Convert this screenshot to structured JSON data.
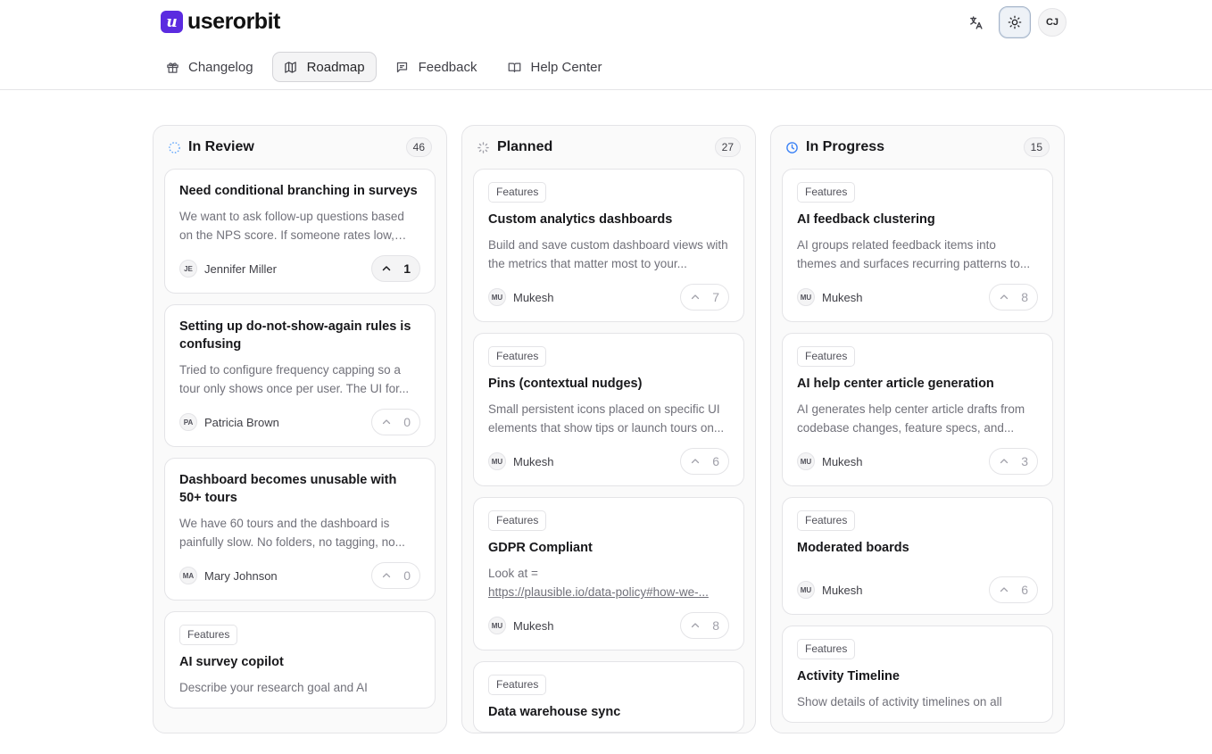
{
  "app": {
    "brand_mark": "u",
    "brand_name": "userorbit"
  },
  "topbar": {
    "translate_icon": "translate-icon",
    "theme_icon": "sun-icon",
    "avatar_initials": "CJ"
  },
  "nav": [
    {
      "label": "Changelog",
      "icon": "gift-icon",
      "active": false
    },
    {
      "label": "Roadmap",
      "icon": "map-icon",
      "active": true
    },
    {
      "label": "Feedback",
      "icon": "message-icon",
      "active": false
    },
    {
      "label": "Help Center",
      "icon": "book-icon",
      "active": false
    }
  ],
  "columns": [
    {
      "title": "In Review",
      "count": "46",
      "status_color": "#60a5fa",
      "cards": [
        {
          "tag": "",
          "title": "Need conditional branching in surveys",
          "desc": "We want to ask follow-up questions based on the NPS score. If someone rates low, as...",
          "initials": "JE",
          "author": "Jennifer Miller",
          "votes": "1",
          "voted": true
        },
        {
          "tag": "",
          "title": "Setting up do-not-show-again rules is confusing",
          "desc": "Tried to configure frequency capping so a tour only shows once per user. The UI for...",
          "initials": "PA",
          "author": "Patricia Brown",
          "votes": "0",
          "voted": false
        },
        {
          "tag": "",
          "title": "Dashboard becomes unusable with 50+ tours",
          "desc": "We have 60 tours and the dashboard is painfully slow. No folders, no tagging, no...",
          "initials": "MA",
          "author": "Mary Johnson",
          "votes": "0",
          "voted": false
        },
        {
          "tag": "Features",
          "title": "AI survey copilot",
          "desc": "Describe your research goal and AI",
          "initials": "",
          "author": "",
          "votes": "",
          "voted": false
        }
      ]
    },
    {
      "title": "Planned",
      "count": "27",
      "status_color": "#a1a1aa",
      "cards": [
        {
          "tag": "Features",
          "title": "Custom analytics dashboards",
          "desc": "Build and save custom dashboard views with the metrics that matter most to your...",
          "initials": "MU",
          "author": "Mukesh",
          "votes": "7",
          "voted": false
        },
        {
          "tag": "Features",
          "title": "Pins (contextual nudges)",
          "desc": "Small persistent icons placed on specific UI elements that show tips or launch tours on...",
          "initials": "MU",
          "author": "Mukesh",
          "votes": "6",
          "voted": false
        },
        {
          "tag": "Features",
          "title": "GDPR Compliant",
          "desc": "Look at =",
          "link": "https://plausible.io/data-policy#how-we-...",
          "initials": "MU",
          "author": "Mukesh",
          "votes": "8",
          "voted": false
        },
        {
          "tag": "Features",
          "title": "Data warehouse sync",
          "desc": "",
          "initials": "",
          "author": "",
          "votes": "",
          "voted": false
        }
      ]
    },
    {
      "title": "In Progress",
      "count": "15",
      "status_color": "#3b82f6",
      "cards": [
        {
          "tag": "Features",
          "title": "AI feedback clustering",
          "desc": "AI groups related feedback items into themes and surfaces recurring patterns to...",
          "initials": "MU",
          "author": "Mukesh",
          "votes": "8",
          "voted": false
        },
        {
          "tag": "Features",
          "title": "AI help center article generation",
          "desc": "AI generates help center article drafts from codebase changes, feature specs, and...",
          "initials": "MU",
          "author": "Mukesh",
          "votes": "3",
          "voted": false
        },
        {
          "tag": "Features",
          "title": "Moderated boards",
          "desc": "",
          "initials": "MU",
          "author": "Mukesh",
          "votes": "6",
          "voted": false
        },
        {
          "tag": "Features",
          "title": "Activity Timeline",
          "desc": "Show details of activity timelines on all",
          "initials": "",
          "author": "",
          "votes": "",
          "voted": false
        }
      ]
    }
  ]
}
